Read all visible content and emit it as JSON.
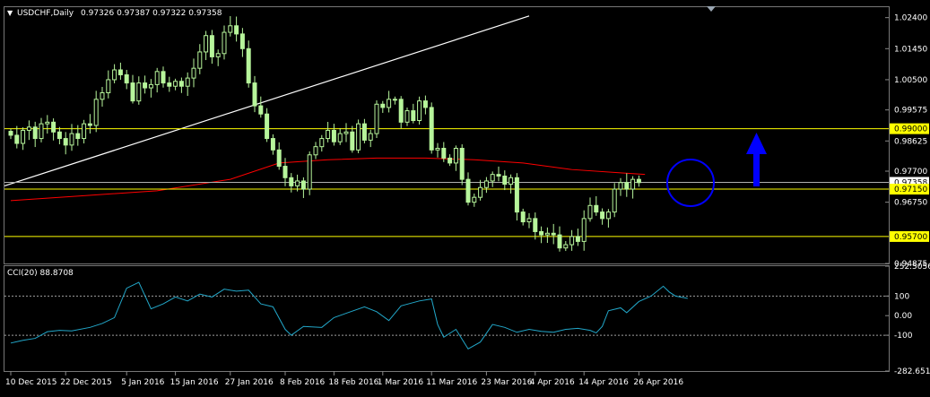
{
  "header": {
    "symbol_label": "USDCHF,Daily",
    "ohlc_values": "0.97326 0.97387 0.97322 0.97358",
    "dropdown_glyph": "▼"
  },
  "indicator": {
    "label": "CCI(20) 88.8708"
  },
  "colors": {
    "background": "#000000",
    "candle_body": "#b7f59b",
    "wick": "#b7f59b",
    "moving_average": "#ff0000",
    "trendline": "#ffffff",
    "level_line": "#ffff00",
    "price_line": "#b0b0b0",
    "cci_line": "#22a7c9",
    "arrow": "#0000ff",
    "circle": "#0000ff",
    "axis_text": "#ffffff",
    "dotted": "#a0a0a0"
  },
  "icons": {
    "trend_arrow": "up-arrow-icon",
    "highlight": "circle-marker-icon"
  },
  "chart_data": [
    {
      "type": "candlestick",
      "title": "USDCHF,Daily",
      "ylim": [
        0.94875,
        1.0272
      ],
      "y_ticks": [
        "1.02400",
        "1.01450",
        "1.00500",
        "0.99575",
        "0.98625",
        "0.97700",
        "0.96750",
        "0.94875"
      ],
      "y_tick_values": [
        1.024,
        1.0145,
        1.005,
        0.99575,
        0.98625,
        0.977,
        0.9675,
        0.94875
      ],
      "x_ticks": [
        "10 Dec 2015",
        "22 Dec 2015",
        "5 Jan 2016",
        "15 Jan 2016",
        "27 Jan 2016",
        "8 Feb 2016",
        "18 Feb 2016",
        "1 Mar 2016",
        "11 Mar 2016",
        "23 Mar 2016",
        "4 Apr 2016",
        "14 Apr 2016",
        "26 Apr 2016"
      ],
      "x_tick_index": [
        0,
        9,
        19,
        27,
        36,
        45,
        53,
        61,
        69,
        78,
        86,
        94,
        103
      ],
      "price_labels": {
        "levels": [
          "0.99000",
          "0.95700"
        ],
        "bid_value": 0.9715,
        "bid": "0.97150",
        "current": "0.97358"
      },
      "levels": [
        0.99,
        0.9715,
        0.957
      ],
      "current_price": 0.97358,
      "closes": [
        0.988,
        0.9855,
        0.9895,
        0.9905,
        0.987,
        0.9915,
        0.992,
        0.989,
        0.987,
        0.985,
        0.9885,
        0.987,
        0.9915,
        0.991,
        0.999,
        1.001,
        1.005,
        1.008,
        1.0065,
        1.004,
        0.9985,
        1.004,
        1.0025,
        1.0035,
        1.0075,
        1.004,
        1.003,
        1.0045,
        1.003,
        1.0055,
        1.0085,
        1.0135,
        1.0185,
        1.012,
        1.013,
        1.0195,
        1.0215,
        1.019,
        1.0145,
        1.004,
        0.997,
        0.9945,
        0.987,
        0.9835,
        0.9785,
        0.975,
        0.9725,
        0.974,
        0.9715,
        0.982,
        0.9845,
        0.987,
        0.9895,
        0.986,
        0.9885,
        0.989,
        0.9835,
        0.9915,
        0.9865,
        0.9885,
        0.9975,
        0.9965,
        0.999,
        0.999,
        0.992,
        0.9955,
        0.9925,
        0.9985,
        0.9965,
        0.9835,
        0.984,
        0.981,
        0.9795,
        0.984,
        0.9745,
        0.9675,
        0.969,
        0.972,
        0.974,
        0.976,
        0.9755,
        0.973,
        0.975,
        0.9645,
        0.9615,
        0.9625,
        0.9585,
        0.9575,
        0.958,
        0.9575,
        0.9535,
        0.9545,
        0.957,
        0.9555,
        0.9625,
        0.9665,
        0.9645,
        0.9625,
        0.9645,
        0.9715,
        0.9735,
        0.9715,
        0.9745,
        0.9735
      ],
      "moving_average": {
        "name": "MA",
        "points": [
          [
            0,
            0.968
          ],
          [
            12,
            0.9695
          ],
          [
            24,
            0.971
          ],
          [
            36,
            0.9745
          ],
          [
            44,
            0.9795
          ],
          [
            52,
            0.9805
          ],
          [
            60,
            0.981
          ],
          [
            68,
            0.981
          ],
          [
            76,
            0.9805
          ],
          [
            84,
            0.9795
          ],
          [
            92,
            0.9775
          ],
          [
            100,
            0.9765
          ],
          [
            104,
            0.976
          ]
        ]
      },
      "trendline": [
        [
          0,
          0.9725
        ],
        [
          85,
          1.0245
        ]
      ]
    },
    {
      "type": "line",
      "title": "CCI(20) 88.8708",
      "ylim": [
        -282.6514,
        252.5056
      ],
      "y_ticks": [
        "252.5056",
        "100",
        "0.00",
        "-100",
        "-282.6514"
      ],
      "y_tick_values": [
        252.5056,
        100,
        0,
        -100,
        -282.6514
      ],
      "dotted_levels": [
        100,
        -100
      ],
      "points": [
        [
          0,
          -140
        ],
        [
          2,
          -126
        ],
        [
          4,
          -116
        ],
        [
          6,
          -82
        ],
        [
          8,
          -75
        ],
        [
          10,
          -78
        ],
        [
          13,
          -60
        ],
        [
          15,
          -40
        ],
        [
          17,
          -10
        ],
        [
          19,
          140
        ],
        [
          21,
          170
        ],
        [
          23,
          35
        ],
        [
          25,
          60
        ],
        [
          27,
          95
        ],
        [
          29,
          75
        ],
        [
          31,
          110
        ],
        [
          33,
          95
        ],
        [
          35,
          135
        ],
        [
          37,
          125
        ],
        [
          39,
          130
        ],
        [
          41,
          60
        ],
        [
          43,
          45
        ],
        [
          45,
          -70
        ],
        [
          46,
          -100
        ],
        [
          48,
          -55
        ],
        [
          51,
          -60
        ],
        [
          53,
          -10
        ],
        [
          55,
          12
        ],
        [
          58,
          45
        ],
        [
          60,
          20
        ],
        [
          62,
          -25
        ],
        [
          64,
          50
        ],
        [
          67,
          75
        ],
        [
          69,
          85
        ],
        [
          70,
          -45
        ],
        [
          71,
          -110
        ],
        [
          73,
          -70
        ],
        [
          75,
          -170
        ],
        [
          77,
          -135
        ],
        [
          79,
          -45
        ],
        [
          81,
          -60
        ],
        [
          83,
          -85
        ],
        [
          85,
          -70
        ],
        [
          87,
          -80
        ],
        [
          89,
          -85
        ],
        [
          91,
          -70
        ],
        [
          93,
          -65
        ],
        [
          95,
          -75
        ],
        [
          96,
          -88
        ],
        [
          97,
          -55
        ],
        [
          98,
          25
        ],
        [
          100,
          40
        ],
        [
          101,
          15
        ],
        [
          103,
          72
        ],
        [
          105,
          100
        ],
        [
          107,
          150
        ],
        [
          108,
          120
        ],
        [
          109,
          100
        ],
        [
          111,
          88
        ]
      ]
    }
  ]
}
